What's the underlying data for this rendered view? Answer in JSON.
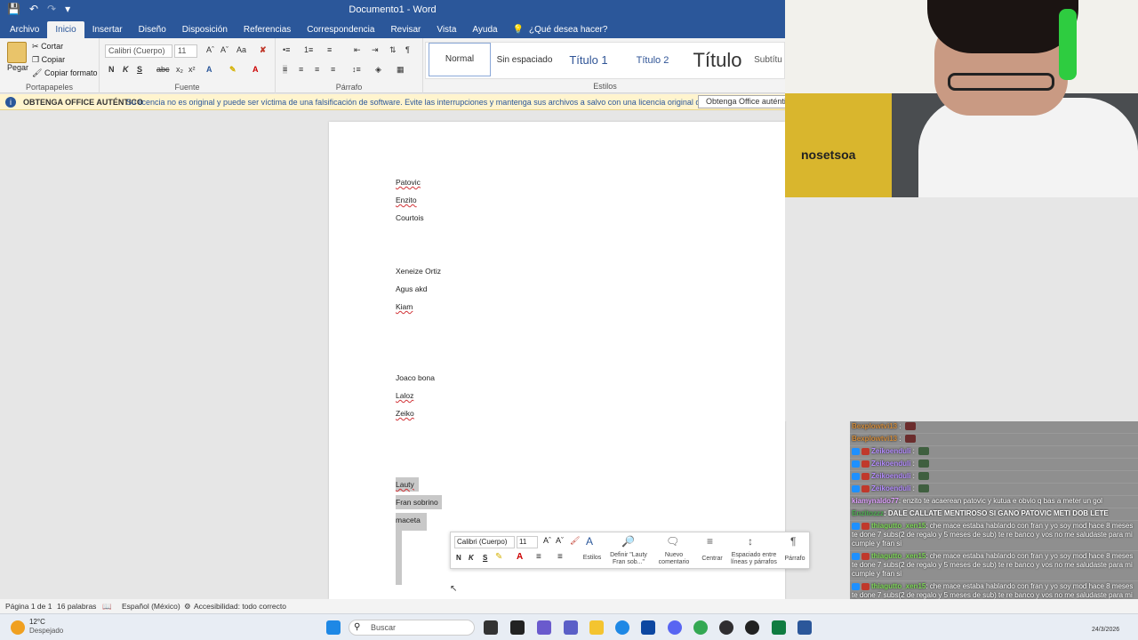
{
  "window": {
    "title": "Documento1 - Word"
  },
  "tabs": [
    "Archivo",
    "Inicio",
    "Insertar",
    "Diseño",
    "Disposición",
    "Referencias",
    "Correspondencia",
    "Revisar",
    "Vista",
    "Ayuda"
  ],
  "tell_me": "¿Qué desea hacer?",
  "ribbon": {
    "clipboard": {
      "paste": "Pegar",
      "cut": "Cortar",
      "copy": "Copiar",
      "format_painter": "Copiar formato",
      "group": "Portapapeles"
    },
    "font": {
      "name": "Calibri (Cuerpo)",
      "size": "11",
      "group": "Fuente",
      "bold": "N",
      "italic": "K",
      "underline": "S"
    },
    "paragraph": {
      "group": "Párrafo"
    },
    "styles": {
      "group": "Estilos",
      "items": [
        "Normal",
        "Sin espaciado",
        "Título 1",
        "Título 2",
        "Título",
        "Subtítu"
      ]
    }
  },
  "warning": {
    "heading": "OBTENGA OFFICE AUTÉNTICO",
    "text": "Su licencia no es original y puede ser víctima de una falsificación de software. Evite las interrupciones y mantenga sus archivos a salvo con una licencia original de Office hoy mismo.",
    "button": "Obtenga Office auténtico"
  },
  "document": {
    "lines": [
      "Patovic",
      "Enzito",
      "Courtois",
      "Xeneize Ortiz",
      "Agus akd",
      "Kiam",
      "Joaco bona",
      "Laloz",
      "Zeiko",
      "Lauty",
      "Fran sobrino",
      "maceta"
    ]
  },
  "mini_toolbar": {
    "font": "Calibri (Cuerpo)",
    "size": "11",
    "bold": "N",
    "italic": "K",
    "underline": "S",
    "commands": [
      "Estilos",
      "Definir \"Lauty Fran sob...\"",
      "Nuevo comentario",
      "Centrar",
      "Espaciado entre líneas y párrafos",
      "Párrafo"
    ]
  },
  "status": {
    "page": "Página 1 de 1",
    "words": "16 palabras",
    "language": "Español (México)",
    "accessibility": "Accesibilidad: todo correcto"
  },
  "taskbar": {
    "weather_temp": "12°C",
    "weather_desc": "Despejado",
    "search": "Buscar",
    "date": "24/3/2026"
  },
  "webcam": {
    "shirt_text": "nosetsoa"
  },
  "chat": [
    {
      "user": "Bexplowtvi13",
      "text": "",
      "emote": "red"
    },
    {
      "user": "Bexplowtvi13",
      "text": "",
      "emote": "red"
    },
    {
      "user": "Zeikoenduli",
      "text": "",
      "emote": "green"
    },
    {
      "user": "Zeikoenduli",
      "text": "",
      "emote": "green"
    },
    {
      "user": "Zeikoenduli",
      "text": "",
      "emote": "green"
    },
    {
      "user": "Zeikoenduli",
      "text": "",
      "emote": "green"
    },
    {
      "user": "kiamynaldo77",
      "text": ": enzito te acaerean patovic y kutua e obvio q bas a meter un gol",
      "emote": ""
    },
    {
      "user": "Enzitozzz",
      "text": ": DALE CALLATE MENTIROSO SI GANO PATOVIC METI DOB LETE",
      "emote": ""
    },
    {
      "user": "thiagutto_xen15",
      "text": ": che mace estaba hablando con fran y yo soy mod hace 8 meses te done 7 subs(2 de regalo y 5 meses de sub) te re banco y vos no me saludaste para mi cumple y fran si",
      "emote": ""
    },
    {
      "user": "thiagutto_xen15",
      "text": ": che mace estaba hablando con fran y yo soy mod hace 8 meses te done 7 subs(2 de regalo y 5 meses de sub) te re banco y vos no me saludaste para mi cumple y fran si",
      "emote": ""
    },
    {
      "user": "thiagutto_xen15",
      "text": ": che mace estaba hablando con fran y yo soy mod hace 8 meses te done 7 subs(2 de regalo y 5 meses de sub) te re banco y vos no me saludaste para mi cumple y fran si",
      "emote": ""
    }
  ]
}
